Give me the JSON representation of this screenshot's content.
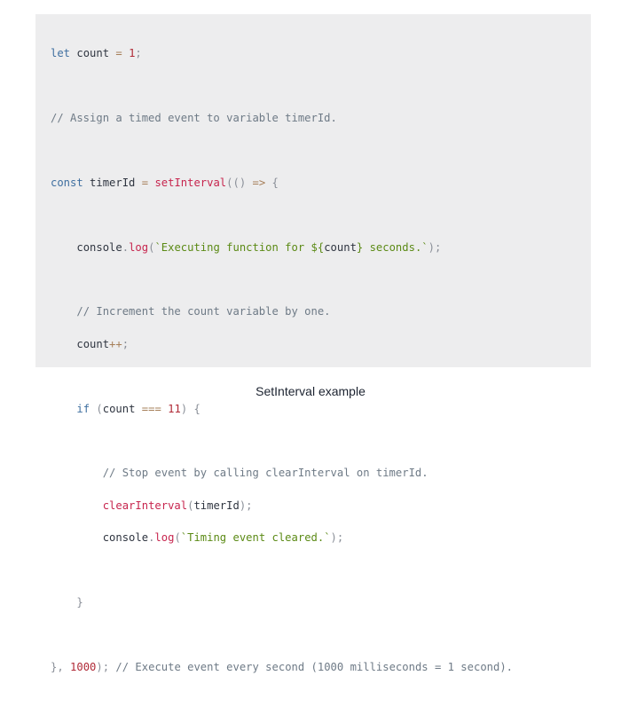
{
  "code": {
    "l1": {
      "kw": "let",
      "id": "count",
      "op": "=",
      "num": "1",
      "semi": ";"
    },
    "l3": {
      "comment": "// Assign a timed event to variable timerId."
    },
    "l5": {
      "kw": "const",
      "id": "timerId",
      "op": "=",
      "fn": "setInterval",
      "paren": "(()",
      "arrow": "=>",
      "brace": "{"
    },
    "l7": {
      "obj": "console",
      "dot": ".",
      "fn": "log",
      "open": "(",
      "str1": "`Executing function for ${",
      "var": "count",
      "str2": "} seconds.`",
      "close": ");"
    },
    "l9": {
      "comment": "// Increment the count variable by one."
    },
    "l10": {
      "id": "count",
      "op": "++",
      "semi": ";"
    },
    "l12": {
      "kw": "if",
      "open": "(",
      "id": "count",
      "op": "===",
      "num": "11",
      "close": ")",
      "brace": "{"
    },
    "l14": {
      "comment": "// Stop event by calling clearInterval on timerId."
    },
    "l15": {
      "fn": "clearInterval",
      "open": "(",
      "id": "timerId",
      "close": ");"
    },
    "l16": {
      "obj": "console",
      "dot": ".",
      "fn": "log",
      "open": "(",
      "str": "`Timing event cleared.`",
      "close": ");"
    },
    "l18": {
      "brace": "}"
    },
    "l20": {
      "close": "},",
      "num": "1000",
      "end": ");",
      "comment": "// Execute event every second (1000 milliseconds = 1 second)."
    }
  },
  "caption": "SetInterval example"
}
